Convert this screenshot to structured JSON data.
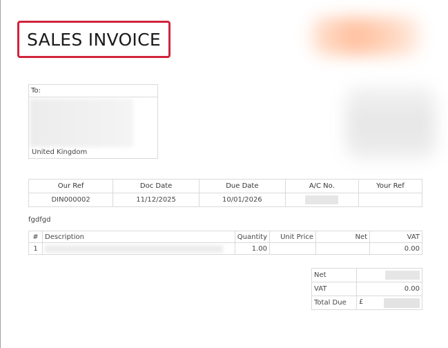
{
  "invoice": {
    "title": "SALES INVOICE"
  },
  "to_box": {
    "label": "To:",
    "country": "United Kingdom"
  },
  "refs": {
    "headers": [
      "Our Ref",
      "Doc Date",
      "Due Date",
      "A/C No.",
      "Your Ref"
    ],
    "values": [
      "DIN000002",
      "11/12/2025",
      "10/01/2026",
      "",
      ""
    ]
  },
  "note": "fgdfgd",
  "items": {
    "headers": [
      "#",
      "Description",
      "Quantity",
      "Unit Price",
      "Net",
      "VAT"
    ],
    "rows": [
      {
        "num": "1",
        "description": "",
        "quantity": "1.00",
        "unit_price": "",
        "net": "",
        "vat": "0.00"
      }
    ]
  },
  "totals": {
    "net_label": "Net",
    "net_value": "",
    "vat_label": "VAT",
    "vat_value": "0.00",
    "total_label": "Total Due",
    "currency_symbol": "£",
    "total_value": ""
  },
  "colors": {
    "title_border": "#d0243a",
    "grid_border": "#d9d9d9"
  }
}
